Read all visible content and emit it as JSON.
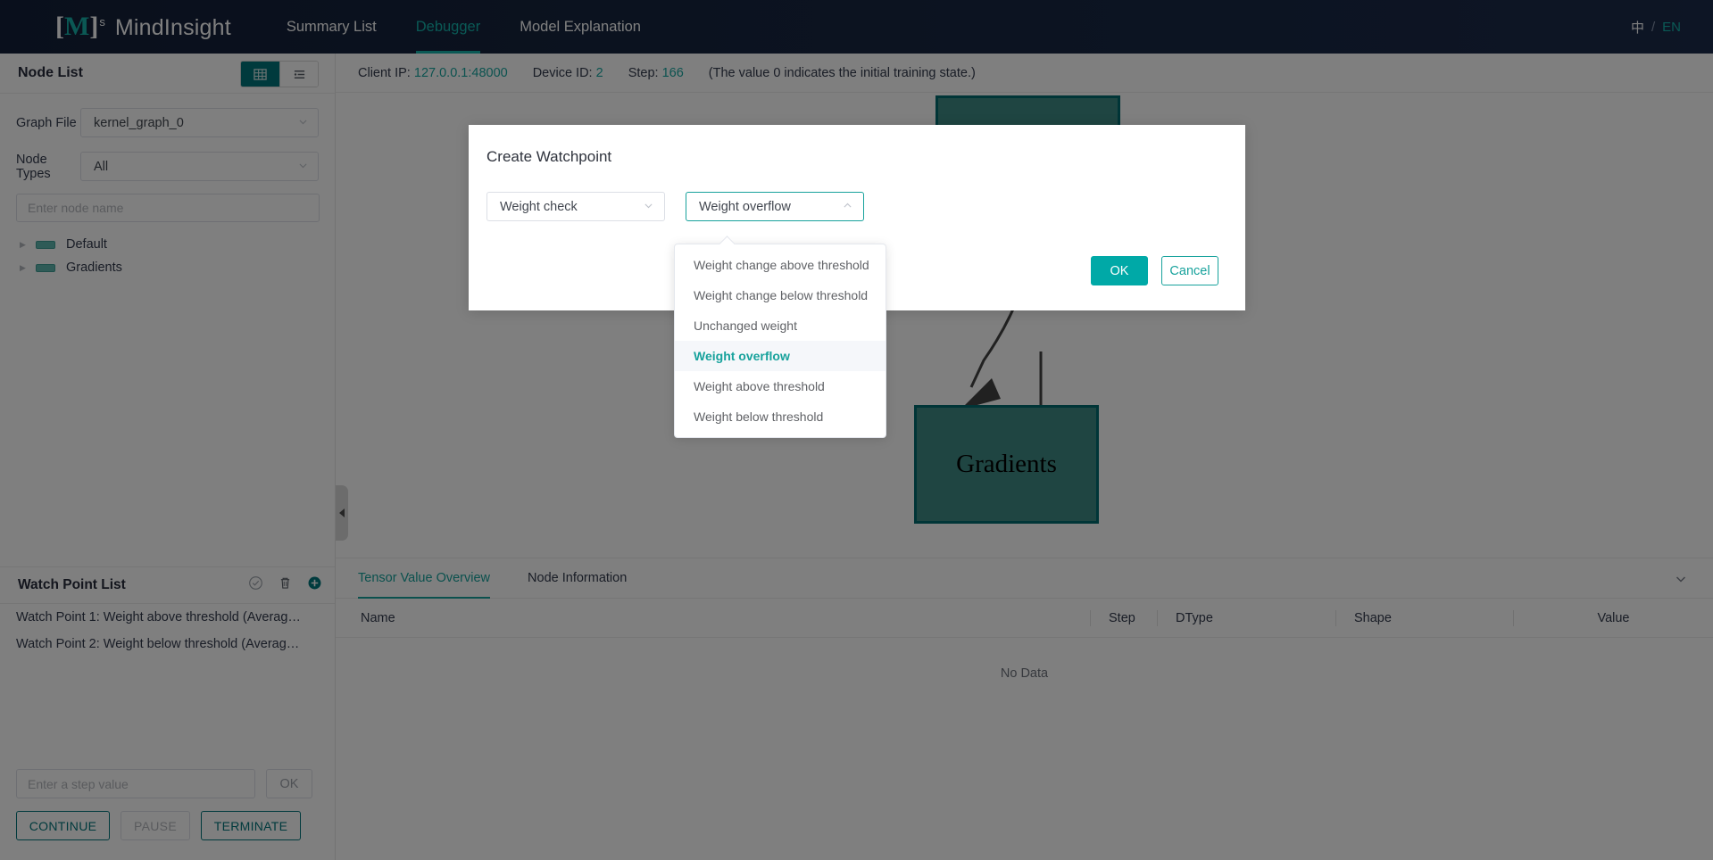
{
  "topnav": {
    "logo_mark": "[M]",
    "logo_sup": "s",
    "logo_text": "MindInsight",
    "items": [
      {
        "label": "Summary List",
        "active": false
      },
      {
        "label": "Debugger",
        "active": true
      },
      {
        "label": "Model Explanation",
        "active": false
      }
    ],
    "lang_zh": "中",
    "lang_sep": "/",
    "lang_en": "EN"
  },
  "sidebar": {
    "title": "Node List",
    "view_toggle": {
      "grid_icon": "grid-view-icon",
      "list_icon": "list-view-icon",
      "active": "grid"
    },
    "graph_file_label": "Graph File",
    "graph_file_value": "kernel_graph_0",
    "node_types_label": "Node Types",
    "node_types_value": "All",
    "node_search_placeholder": "Enter node name",
    "node_search_value": "",
    "tree": [
      {
        "label": "Default"
      },
      {
        "label": "Gradients"
      }
    ],
    "watchpoint": {
      "title": "Watch Point List",
      "actions": [
        "check-circle-icon",
        "trash-icon",
        "add-circle-icon"
      ],
      "items": [
        {
          "label": "Watch Point 1: Weight above threshold (Averag…"
        },
        {
          "label": "Watch Point 2: Weight below threshold (Averag…"
        }
      ]
    },
    "controls": {
      "step_placeholder": "Enter a step value",
      "step_value": "",
      "ok_label": "OK",
      "continue_label": "CONTINUE",
      "pause_label": "PAUSE",
      "terminate_label": "TERMINATE"
    }
  },
  "main": {
    "info": {
      "client_ip_label": "Client IP:",
      "client_ip_value": "127.0.0.1:48000",
      "device_id_label": "Device ID:",
      "device_id_value": "2",
      "step_label": "Step:",
      "step_value": "166",
      "hint": "(The value 0 indicates the initial training state.)"
    },
    "graph": {
      "nodes": [
        {
          "label": "",
          "name": "graph-node-top"
        },
        {
          "label": "Gradients",
          "name": "graph-node-gradients"
        }
      ]
    },
    "panel": {
      "tabs": [
        {
          "label": "Tensor Value Overview",
          "active": true
        },
        {
          "label": "Node Information",
          "active": false
        }
      ],
      "columns": [
        "Name",
        "Step",
        "DType",
        "Shape",
        "Value"
      ],
      "empty_text": "No Data"
    }
  },
  "modal": {
    "title": "Create Watchpoint",
    "category_value": "Weight check",
    "condition_value": "Weight overflow",
    "ok_label": "OK",
    "cancel_label": "Cancel",
    "dropdown_options": [
      {
        "label": "Weight change above threshold",
        "selected": false
      },
      {
        "label": "Weight change below threshold",
        "selected": false
      },
      {
        "label": "Unchanged weight",
        "selected": false
      },
      {
        "label": "Weight overflow",
        "selected": true
      },
      {
        "label": "Weight above threshold",
        "selected": false
      },
      {
        "label": "Weight below threshold",
        "selected": false
      }
    ]
  },
  "colors": {
    "accent": "#17a29c",
    "nav_bg": "#17253f",
    "node_fill": "#3f8a85",
    "node_border": "#006b6e",
    "primary_btn": "#00a9a7"
  }
}
